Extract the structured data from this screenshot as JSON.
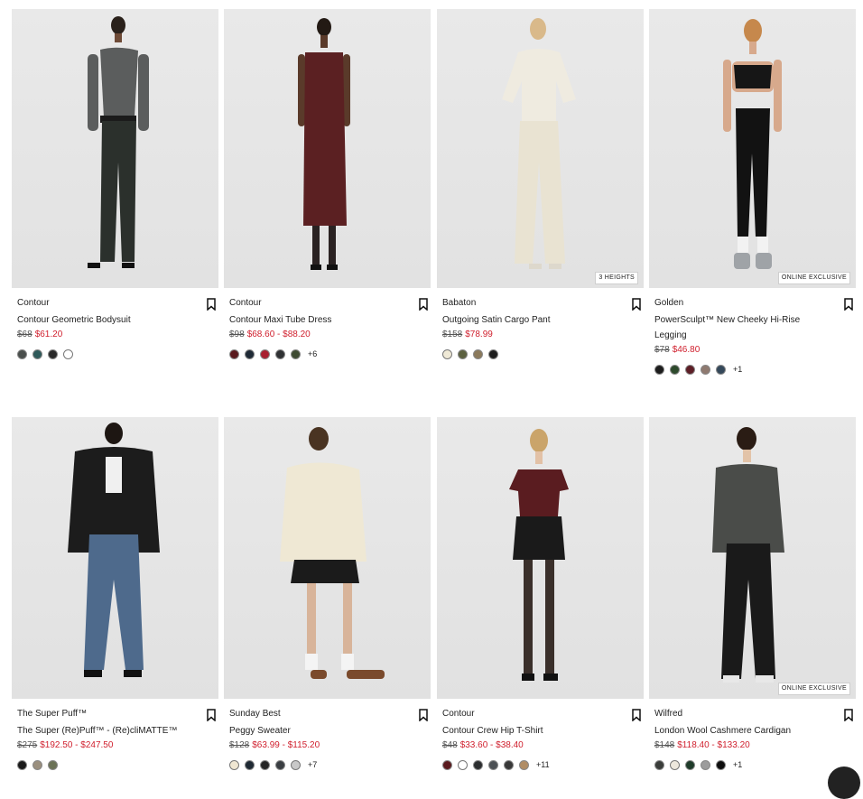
{
  "products": [
    {
      "brand": "Contour",
      "name": "Contour Geometric Bodysuit",
      "old_price": "$68",
      "sale_price": "$61.20",
      "badge": "",
      "swatches": [
        "#4a4f4c",
        "#2f5a5a",
        "#2a2a2a",
        "#ffffff"
      ],
      "more": ""
    },
    {
      "brand": "Contour",
      "name": "Contour Maxi Tube Dress",
      "old_price": "$98",
      "sale_price": "$68.60 - $88.20",
      "badge": "",
      "swatches": [
        "#5a1a1e",
        "#1f2a36",
        "#a82030",
        "#2f3133",
        "#3e4b32"
      ],
      "more": "+6"
    },
    {
      "brand": "Babaton",
      "name": "Outgoing Satin Cargo Pant",
      "old_price": "$158",
      "sale_price": "$78.99",
      "badge": "3 HEIGHTS",
      "swatches": [
        "#efe9d6",
        "#5c6140",
        "#8b7a5c",
        "#1e1e1e"
      ],
      "more": ""
    },
    {
      "brand": "Golden",
      "name": "PowerSculpt™ New Cheeky Hi-Rise Legging",
      "old_price": "$78",
      "sale_price": "$46.80",
      "badge": "ONLINE EXCLUSIVE",
      "swatches": [
        "#1c1c1c",
        "#2d4a2c",
        "#5d1e26",
        "#8f7a70",
        "#34485a"
      ],
      "more": "+1"
    },
    {
      "brand": "The Super Puff™",
      "name": "The Super (Re)Puff™ - (Re)cliMATTE™",
      "old_price": "$275",
      "sale_price": "$192.50 - $247.50",
      "badge": "",
      "swatches": [
        "#1a1a1a",
        "#9a8f7e",
        "#6b7256"
      ],
      "more": ""
    },
    {
      "brand": "Sunday Best",
      "name": "Peggy Sweater",
      "old_price": "$128",
      "sale_price": "$63.99 - $115.20",
      "badge": "",
      "swatches": [
        "#efe6d2",
        "#1f2933",
        "#262626",
        "#3a3e42",
        "#c8c8c8"
      ],
      "more": "+7"
    },
    {
      "brand": "Contour",
      "name": "Contour Crew Hip T-Shirt",
      "old_price": "$48",
      "sale_price": "$33.60 - $38.40",
      "badge": "",
      "swatches": [
        "#5a1a1e",
        "#ffffff",
        "#2c2e30",
        "#4c5054",
        "#383838",
        "#b08d66"
      ],
      "more": "+11"
    },
    {
      "brand": "Wilfred",
      "name": "London Wool Cashmere Cardigan",
      "old_price": "$148",
      "sale_price": "$118.40 - $133.20",
      "badge": "ONLINE EXCLUSIVE",
      "swatches": [
        "#3a3d3a",
        "#ece7dc",
        "#1f3b2a",
        "#9c9c9c",
        "#0e0e0e"
      ],
      "more": "+1"
    }
  ],
  "icons": {
    "bookmark": "bookmark-icon",
    "chat": "chat-icon"
  }
}
